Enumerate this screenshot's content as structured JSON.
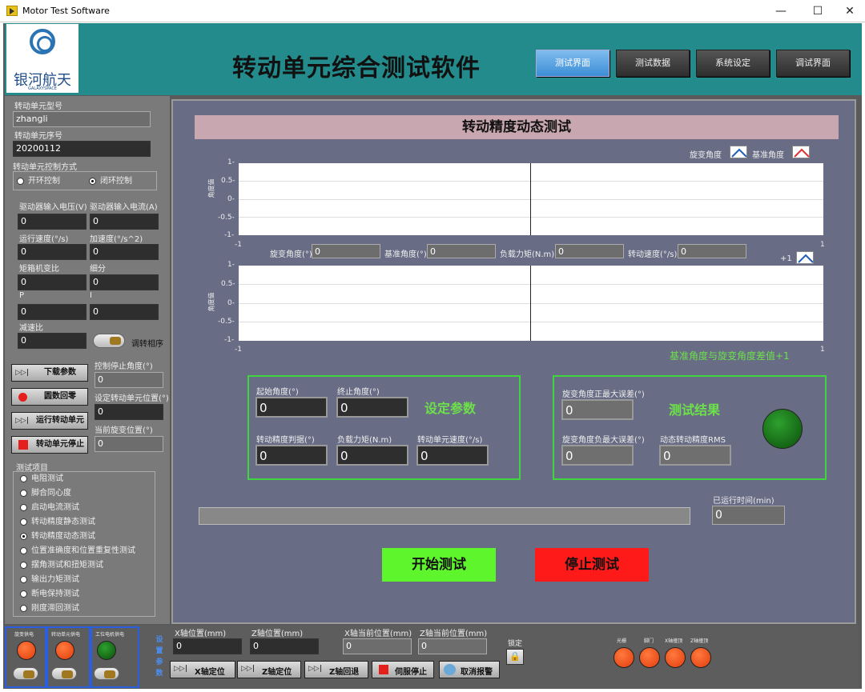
{
  "window": {
    "title": "Motor Test Software",
    "minimize": "—",
    "maximize": "☐",
    "close": "✕"
  },
  "header": {
    "logo_cn": "银河航天",
    "logo_en": "GALAXYSPACE",
    "app_title": "转动单元综合测试软件",
    "nav": [
      "测试界面",
      "测试数据",
      "系统设定",
      "调试界面"
    ],
    "active_nav": "测试界面"
  },
  "left": {
    "model_label": "转动单元型号",
    "model_value": "zhangli",
    "serial_label": "转动单元序号",
    "serial_value": "20200112",
    "control_mode_label": "转动单元控制方式",
    "open_loop": "开环控制",
    "closed_loop": "闭环控制",
    "voltage_label": "驱动器输入电压(V)",
    "voltage_value": "0",
    "current_label": "驱动器输入电流(A)",
    "current_value": "0",
    "speed_label": "运行速度(°/s)",
    "speed_value": "0",
    "accel_label": "加速度(°/s^2)",
    "accel_value": "0",
    "ratio_label": "矩箱机变比",
    "ratio_value": "0",
    "subdiv_label": "细分",
    "subdiv_value": "0",
    "p_label": "P",
    "p_value": "0",
    "i_label": "I",
    "i_value": "0",
    "reduce_label": "减速比",
    "reduce_value": "0",
    "phase_label": "调转相序",
    "download_btn": "下载参数",
    "stop_angle_label": "控制停止角度(°)",
    "stop_angle_value": "0",
    "home_btn": "圆数回零",
    "set_pos_label": "设定转动单元位置(°)",
    "set_pos_value": "0",
    "run_btn": "运行转动单元",
    "cur_pos_label": "当前旋变位置(°)",
    "cur_pos_value": "0",
    "stop_btn": "转动单元停止",
    "test_items_label": "测试项目",
    "test_items": [
      "电阻测试",
      "脚合同心度",
      "启动电流测试",
      "转动精度静态测试",
      "转动精度动态测试",
      "位置准确度和位置重复性测试",
      "摆角测试和扭矩测试",
      "输出力矩测试",
      "断电保持测试",
      "刚度滞回测试"
    ],
    "selected_item": 4
  },
  "main": {
    "section_title": "转动精度动态测试",
    "legend1_a": "旋变角度",
    "legend1_b": "基准角度",
    "chart1_ylabel": "角度值",
    "yticks": [
      "1-",
      "0.5-",
      "0-",
      "-0.5-",
      "-1-"
    ],
    "xticks": [
      "-1",
      "1"
    ],
    "readouts": {
      "resolver_label": "旋变角度(°)",
      "resolver_value": "0",
      "ref_label": "基准角度(°)",
      "ref_value": "0",
      "torque_label": "负载力矩(N.m)",
      "torque_value": "0",
      "speed_label": "转动速度(°/s)",
      "speed_value": "0"
    },
    "legend2": "+1",
    "chart2_ylabel": "角度值",
    "chart2_caption": "基准角度与旋变角度差值+1",
    "settings": {
      "title": "设定参数",
      "start_label": "起始角度(°)",
      "start_value": "0",
      "end_label": "终止角度(°)",
      "end_value": "0",
      "accuracy_label": "转动精度判据(°)",
      "accuracy_value": "0",
      "load_label": "负载力矩(N.m)",
      "load_value": "0",
      "unit_speed_label": "转动单元速度(°/s)",
      "unit_speed_value": "0"
    },
    "results": {
      "title": "测试结果",
      "pos_err_label": "旋变角度正最大误差(°)",
      "pos_err_value": "0",
      "neg_err_label": "旋变角度负最大误差(°)",
      "neg_err_value": "0",
      "rms_label": "动态转动精度RMS",
      "rms_value": "0"
    },
    "progress": 0.0,
    "elapsed_label": "已运行时间(min)",
    "elapsed_value": "0",
    "start_btn": "开始测试",
    "stop_btn": "停止测试",
    "colors": {
      "start": "#5ff52c",
      "stop": "#ff1a1a",
      "green": "#6de14a"
    }
  },
  "bottom": {
    "power1": "旋变供电",
    "power2": "转动单元供电",
    "power3": "工位电机供电",
    "vert": [
      "设",
      "置",
      "参",
      "数"
    ],
    "x_pos_label": "X轴位置(mm)",
    "x_pos_value": "0",
    "z_pos_label": "Z轴位置(mm)",
    "z_pos_value": "0",
    "x_cur_label": "X轴当前位置(mm)",
    "x_cur_value": "0",
    "z_cur_label": "Z轴当前位置(mm)",
    "z_cur_value": "0",
    "lock_label": "锁定",
    "x_locate": "X轴定位",
    "z_locate": "Z轴定位",
    "z_back": "Z轴回退",
    "servo_stop": "伺服停止",
    "cancel_alarm": "取消报警",
    "ind": [
      "光栅",
      "脚门",
      "X轴撞顶",
      "Z轴撞顶"
    ]
  }
}
